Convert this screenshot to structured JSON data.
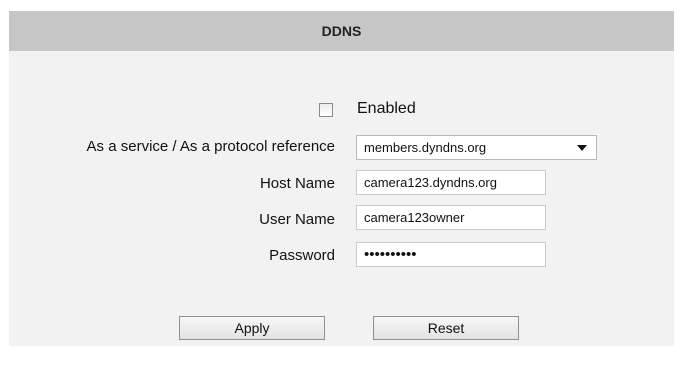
{
  "panel": {
    "title": "DDNS"
  },
  "form": {
    "enabled": {
      "label": "Enabled",
      "checked": false
    },
    "service": {
      "label": "As a service / As a protocol reference",
      "value": "members.dyndns.org"
    },
    "host_name": {
      "label": "Host Name",
      "value": "camera123.dyndns.org"
    },
    "user_name": {
      "label": "User Name",
      "value": "camera123owner"
    },
    "password": {
      "label": "Password",
      "value": "••••••••••"
    }
  },
  "buttons": {
    "apply": "Apply",
    "reset": "Reset"
  },
  "icons": {
    "dropdown": "chevron-down-icon"
  }
}
